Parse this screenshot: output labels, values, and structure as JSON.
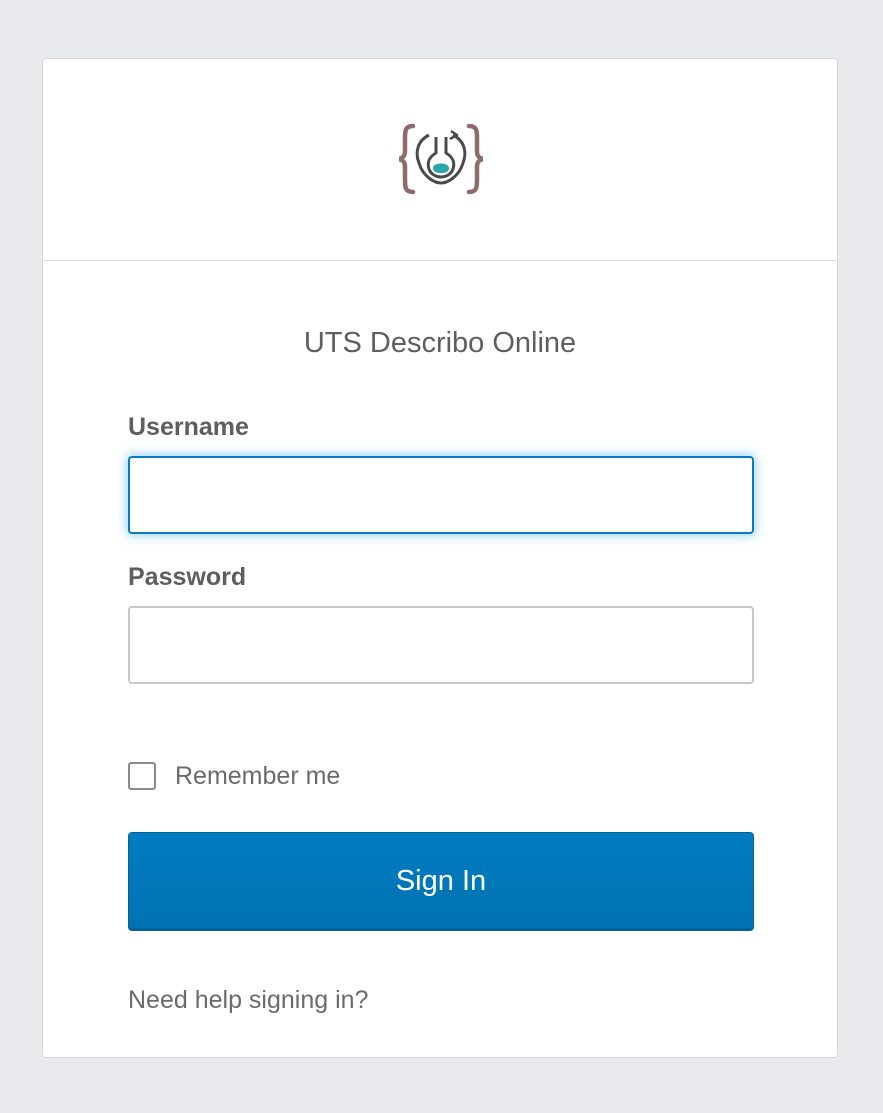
{
  "app": {
    "title": "UTS Describo Online"
  },
  "logo": {
    "icon": "describo-logo-icon",
    "brace_color": "#8f6a6a",
    "flask_color": "#4a4a4a",
    "liquid_color": "#2aa6a8"
  },
  "form": {
    "username_label": "Username",
    "username_value": "",
    "password_label": "Password",
    "password_value": "",
    "remember_label": "Remember me",
    "remember_checked": false,
    "signin_label": "Sign In",
    "help_link": "Need help signing in?"
  },
  "colors": {
    "page_background": "#e8e9ec",
    "accent": "#007dc1",
    "focus_border": "#0b7cc3"
  }
}
